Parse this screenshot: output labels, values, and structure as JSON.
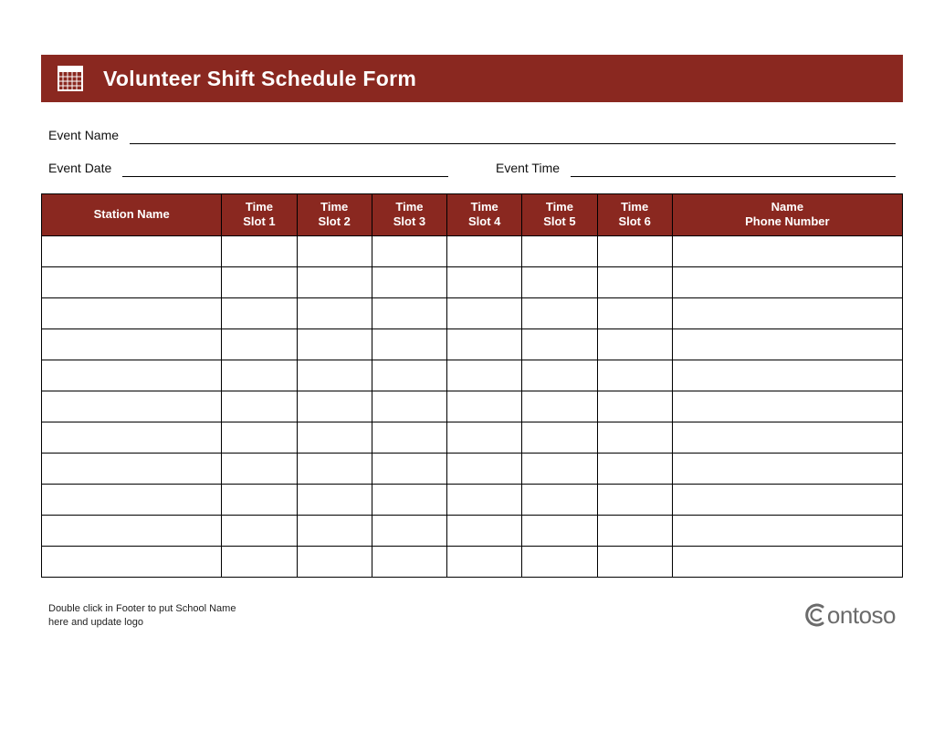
{
  "header": {
    "title": "Volunteer Shift Schedule Form"
  },
  "fields": {
    "event_name_label": "Event Name",
    "event_date_label": "Event Date",
    "event_time_label": "Event Time",
    "event_name_value": "",
    "event_date_value": "",
    "event_time_value": ""
  },
  "table": {
    "headers": {
      "station": "Station Name",
      "slot1_l1": "Time",
      "slot1_l2": "Slot 1",
      "slot2_l1": "Time",
      "slot2_l2": "Slot 2",
      "slot3_l1": "Time",
      "slot3_l2": "Slot 3",
      "slot4_l1": "Time",
      "slot4_l2": "Slot 4",
      "slot5_l1": "Time",
      "slot5_l2": "Slot 5",
      "slot6_l1": "Time",
      "slot6_l2": "Slot 6",
      "name_l1": "Name",
      "name_l2": "Phone Number"
    },
    "rows": [
      {
        "station": "",
        "s1": "",
        "s2": "",
        "s3": "",
        "s4": "",
        "s5": "",
        "s6": "",
        "name": ""
      },
      {
        "station": "",
        "s1": "",
        "s2": "",
        "s3": "",
        "s4": "",
        "s5": "",
        "s6": "",
        "name": ""
      },
      {
        "station": "",
        "s1": "",
        "s2": "",
        "s3": "",
        "s4": "",
        "s5": "",
        "s6": "",
        "name": ""
      },
      {
        "station": "",
        "s1": "",
        "s2": "",
        "s3": "",
        "s4": "",
        "s5": "",
        "s6": "",
        "name": ""
      },
      {
        "station": "",
        "s1": "",
        "s2": "",
        "s3": "",
        "s4": "",
        "s5": "",
        "s6": "",
        "name": ""
      },
      {
        "station": "",
        "s1": "",
        "s2": "",
        "s3": "",
        "s4": "",
        "s5": "",
        "s6": "",
        "name": ""
      },
      {
        "station": "",
        "s1": "",
        "s2": "",
        "s3": "",
        "s4": "",
        "s5": "",
        "s6": "",
        "name": ""
      },
      {
        "station": "",
        "s1": "",
        "s2": "",
        "s3": "",
        "s4": "",
        "s5": "",
        "s6": "",
        "name": ""
      },
      {
        "station": "",
        "s1": "",
        "s2": "",
        "s3": "",
        "s4": "",
        "s5": "",
        "s6": "",
        "name": ""
      },
      {
        "station": "",
        "s1": "",
        "s2": "",
        "s3": "",
        "s4": "",
        "s5": "",
        "s6": "",
        "name": ""
      },
      {
        "station": "",
        "s1": "",
        "s2": "",
        "s3": "",
        "s4": "",
        "s5": "",
        "s6": "",
        "name": ""
      }
    ]
  },
  "footer": {
    "note_l1": "Double click in Footer to put School Name",
    "note_l2": "here and update logo",
    "brand": "ontoso"
  },
  "colors": {
    "accent": "#8a2820"
  }
}
